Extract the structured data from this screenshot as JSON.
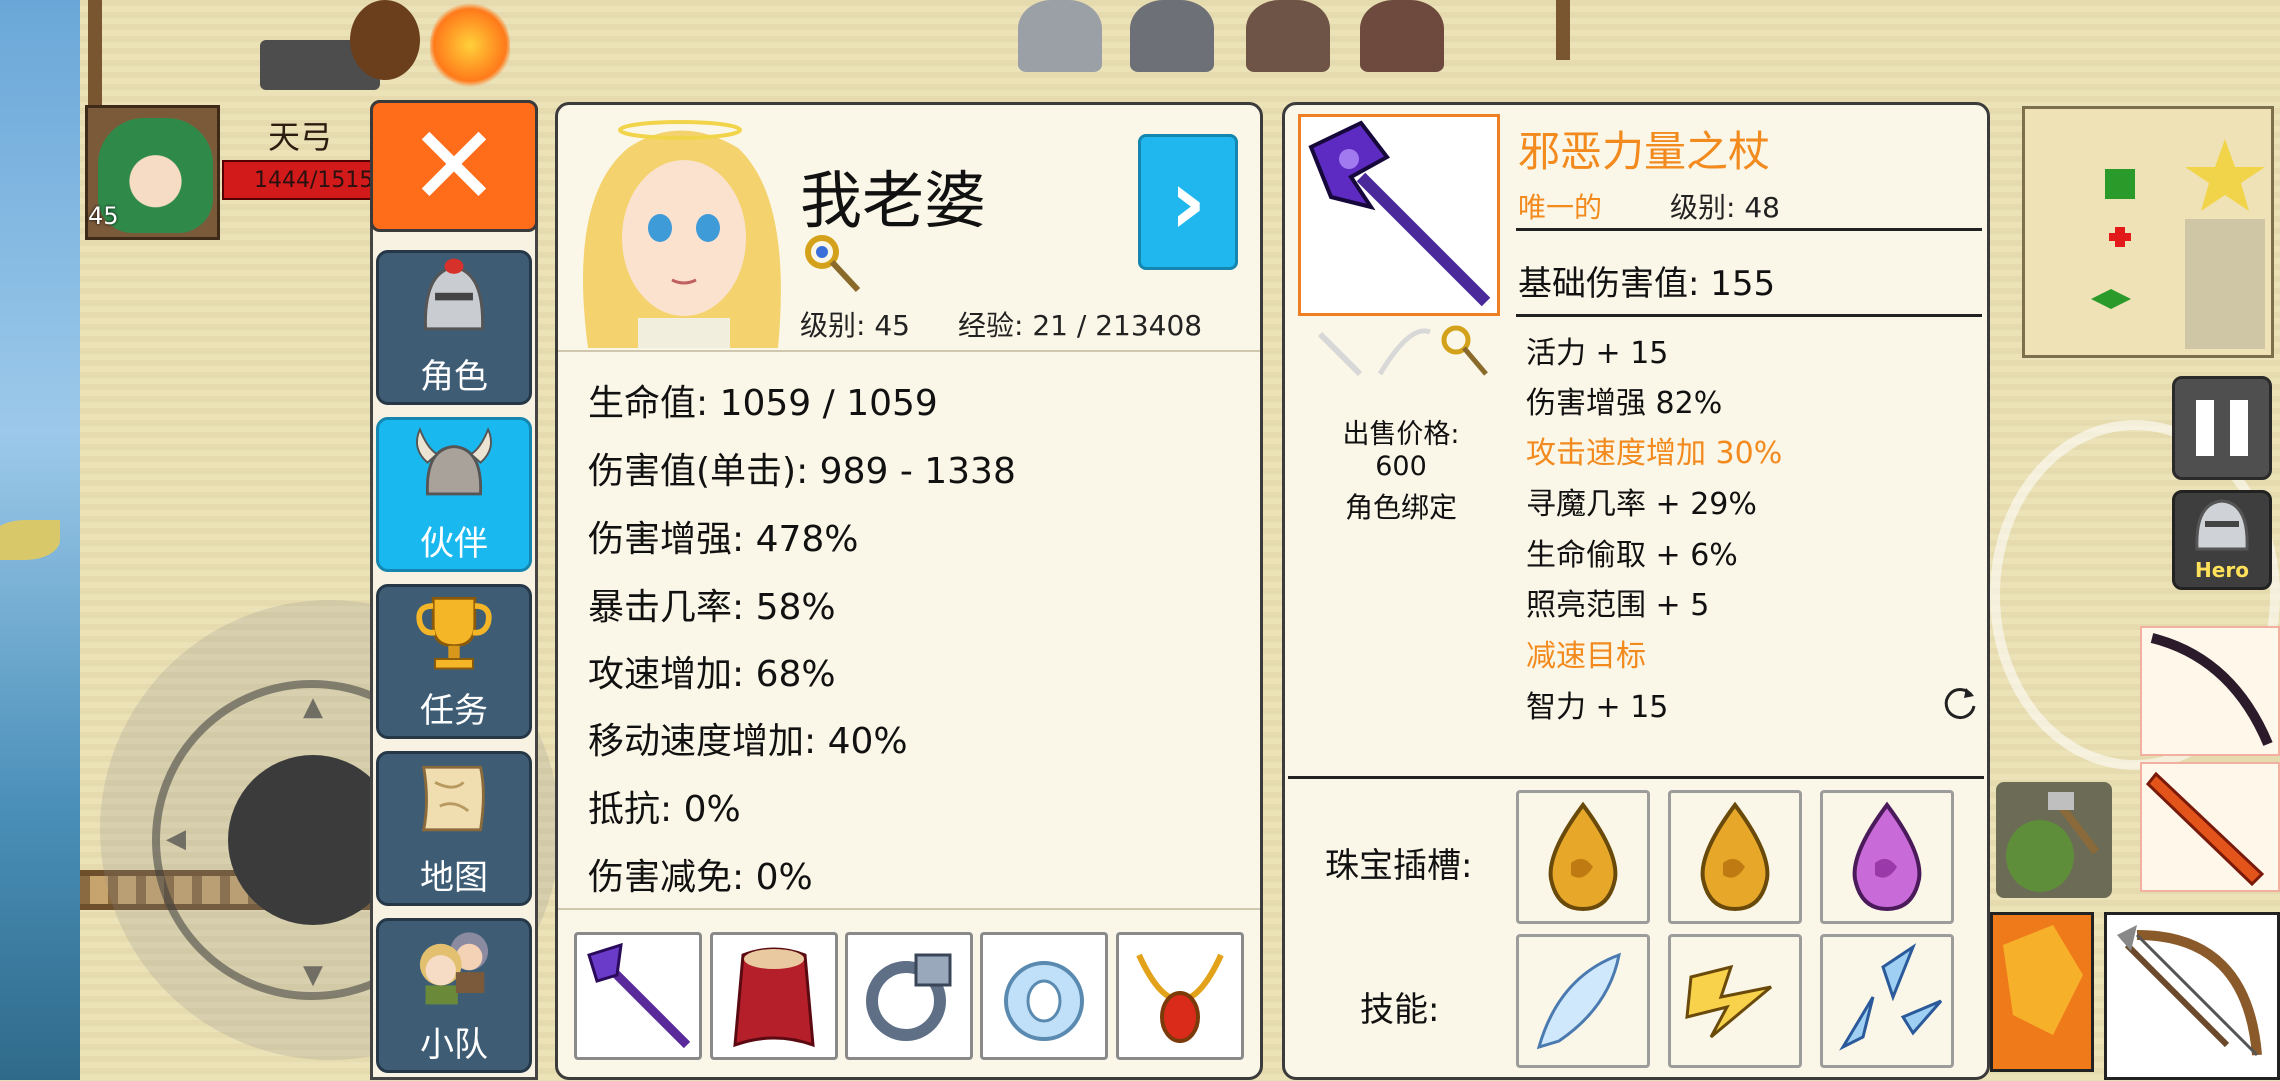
{
  "hero": {
    "name": "天弓",
    "hp_text": "1444/1515",
    "level": "45"
  },
  "nav": {
    "close_label": "✕",
    "items": [
      {
        "label": "角色",
        "icon": "knight-helmet-icon",
        "active": false
      },
      {
        "label": "伙伴",
        "icon": "horned-helmet-icon",
        "active": true
      },
      {
        "label": "任务",
        "icon": "trophy-icon",
        "active": false
      },
      {
        "label": "地图",
        "icon": "scroll-map-icon",
        "active": false
      },
      {
        "label": "小队",
        "icon": "party-icon",
        "active": false
      }
    ]
  },
  "companion": {
    "name": "我老婆",
    "level_text": "级别: 45",
    "exp_text": "经验: 21 / 213408",
    "next_label": "›",
    "stats": [
      "生命值: 1059 / 1059",
      "伤害值(单击): 989 - 1338",
      "伤害增强: 478%",
      "暴击几率: 58%",
      "攻速增加: 68%",
      "移动速度增加: 40%",
      "抵抗: 0%",
      "伤害减免: 0%"
    ],
    "equipment": [
      "staff-icon",
      "cloak-icon",
      "ring-icon",
      "crystal-ring-icon",
      "amulet-icon"
    ]
  },
  "item": {
    "name": "邪恶力量之杖",
    "rarity": "唯一的",
    "level_text": "级别: 48",
    "base_damage": "基础伤害值: 155",
    "attributes": [
      {
        "text": "活力 + 15",
        "highlight": false
      },
      {
        "text": "伤害增强 82%",
        "highlight": false
      },
      {
        "text": "攻击速度增加 30%",
        "highlight": true
      },
      {
        "text": "寻魔几率 + 29%",
        "highlight": false
      },
      {
        "text": "生命偷取 + 6%",
        "highlight": false
      },
      {
        "text": "照亮范围 + 5",
        "highlight": false
      },
      {
        "text": "减速目标",
        "highlight": true
      },
      {
        "text": "智力 + 15",
        "highlight": false
      }
    ],
    "sell_price": "出售价格: 600",
    "bind_text": "角色绑定",
    "gem_label": "珠宝插槽:",
    "gems": [
      "amber-gem-icon",
      "amber-gem-icon",
      "violet-gem-icon"
    ],
    "skill_label": "技能:",
    "skills": [
      "ice-feather-icon",
      "lightning-icon",
      "ice-shards-icon"
    ]
  },
  "hud": {
    "hero_button_label": "Hero"
  },
  "colors": {
    "accent_orange": "#f28a1e",
    "close_orange": "#ff6c1a",
    "active_blue": "#19b8ef",
    "nav_slate": "#3e5d74"
  }
}
